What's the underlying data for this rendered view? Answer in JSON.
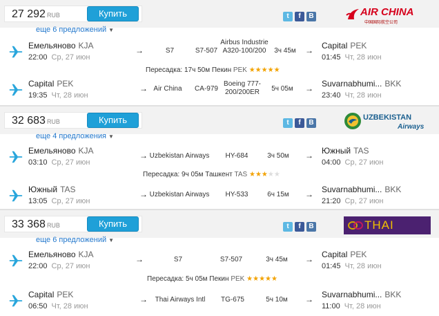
{
  "offers": [
    {
      "price": "27 292",
      "currency": "RUB",
      "buy_label": "Купить",
      "more_offers": "еще 6 предложений",
      "airline": "AIR CHINA",
      "airline_sub": "中国国际航空公司",
      "airline_color": "#d6001c",
      "segments": [
        {
          "from_city": "Емельяново",
          "from_code": "KJA",
          "dep_time": "22:00",
          "dep_date": "Ср, 27 июн",
          "carrier": "S7",
          "flight": "S7-507",
          "aircraft": "Airbus Industrie A320-100/200",
          "duration": "3ч 45м",
          "to_city": "Capital",
          "to_code": "PEK",
          "arr_time": "01:45",
          "arr_date": "Чт, 28 июн"
        },
        {
          "from_city": "Capital",
          "from_code": "PEK",
          "dep_time": "19:35",
          "dep_date": "Чт, 28 июн",
          "carrier": "Air China",
          "flight": "CA-979",
          "aircraft": "Boeing 777-200/200ER",
          "duration": "5ч 05м",
          "to_city": "Suvarnabhumi...",
          "to_code": "BKK",
          "arr_time": "23:40",
          "arr_date": "Чт, 28 июн"
        }
      ],
      "transfer": {
        "label": "Пересадка: 17ч 50м Пекин",
        "code": "PEK",
        "rating": 5
      }
    },
    {
      "price": "32 683",
      "currency": "RUB",
      "buy_label": "Купить",
      "more_offers": "еще 4 предложения",
      "airline": "UZBEKISTAN",
      "airline_sub": "Airways",
      "airline_color": "#1a5f8f",
      "segments": [
        {
          "from_city": "Емельяново",
          "from_code": "KJA",
          "dep_time": "03:10",
          "dep_date": "Ср, 27 июн",
          "carrier": "Uzbekistan Airways",
          "flight": "HY-684",
          "aircraft": "",
          "duration": "3ч 50м",
          "to_city": "Южный",
          "to_code": "TAS",
          "arr_time": "04:00",
          "arr_date": "Ср, 27 июн"
        },
        {
          "from_city": "Южный",
          "from_code": "TAS",
          "dep_time": "13:05",
          "dep_date": "Ср, 27 июн",
          "carrier": "Uzbekistan Airways",
          "flight": "HY-533",
          "aircraft": "",
          "duration": "6ч 15м",
          "to_city": "Suvarnabhumi...",
          "to_code": "BKK",
          "arr_time": "21:20",
          "arr_date": "Ср, 27 июн"
        }
      ],
      "transfer": {
        "label": "Пересадка: 9ч 05м Ташкент",
        "code": "TAS",
        "rating": 3
      }
    },
    {
      "price": "33 368",
      "currency": "RUB",
      "buy_label": "Купить",
      "more_offers": "еще 6 предложений",
      "airline": "THAI",
      "airline_sub": "",
      "airline_color": "#4b2170",
      "segments": [
        {
          "from_city": "Емельяново",
          "from_code": "KJA",
          "dep_time": "22:00",
          "dep_date": "Ср, 27 июн",
          "carrier": "S7",
          "flight": "S7-507",
          "aircraft": "",
          "duration": "3ч 45м",
          "to_city": "Capital",
          "to_code": "PEK",
          "arr_time": "01:45",
          "arr_date": "Чт, 28 июн"
        },
        {
          "from_city": "Capital",
          "from_code": "PEK",
          "dep_time": "06:50",
          "dep_date": "Чт, 28 июн",
          "carrier": "Thai Airways Intl",
          "flight": "TG-675",
          "aircraft": "",
          "duration": "5ч 10м",
          "to_city": "Suvarnabhumi...",
          "to_code": "BKK",
          "arr_time": "11:00",
          "arr_date": "Чт, 28 июн"
        }
      ],
      "transfer": {
        "label": "Пересадка: 5ч 05м Пекин",
        "code": "PEK",
        "rating": 5
      }
    }
  ],
  "social": {
    "twitter": "t",
    "facebook": "f",
    "vkontakte": "B"
  },
  "icons": {
    "plane": "plane-icon",
    "arrow": "→",
    "star": "★",
    "caret": "▼"
  }
}
